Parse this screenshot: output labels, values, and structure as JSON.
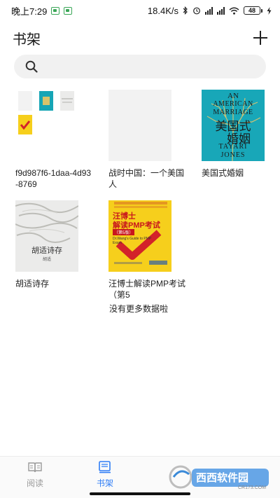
{
  "status_bar": {
    "time": "晚上7:29",
    "net_speed": "18.4K/s",
    "battery": "48",
    "colors": {
      "app_icon": "#3aa657",
      "battery": "#2fb14a"
    }
  },
  "header": {
    "title": "书架",
    "add_icon": "plus-icon"
  },
  "search": {
    "icon": "search-icon",
    "placeholder": ""
  },
  "shelf": {
    "books": [
      {
        "label": "f9d987f6-1daa-4d93-8769"
      },
      {
        "label": "战时中国：一个美国人"
      },
      {
        "label": "美国式婚姻"
      },
      {
        "label": "胡适诗存"
      },
      {
        "label": "汪博士解读PMP考试（第5"
      }
    ],
    "covers": {
      "american_marriage": {
        "line1": "AN",
        "line2": "AMERICAN",
        "line3": "MARRIAGE",
        "line4": "美国式",
        "line5": "婚姻",
        "line6": "TAYARI",
        "line7": "JONES",
        "color": "#18a7b8"
      },
      "poem": {
        "title": "胡适诗存",
        "subtitle": "胡适"
      },
      "pmp": {
        "line1": "汪博士",
        "line2": "解读PMP",
        "line3": "考试",
        "edition": "（第5版）",
        "english": "Dr.Wang's Guide to PMP Exam",
        "color": "#f6cf1c"
      }
    },
    "no_more": "没有更多数据啦"
  },
  "bottom_nav": {
    "items": [
      {
        "label": "阅读",
        "icon": "open-book-icon",
        "active": false
      },
      {
        "label": "书架",
        "icon": "bookshelf-icon",
        "active": true
      }
    ],
    "active_color": "#2f7df6",
    "inactive_color": "#9a9a9a"
  },
  "watermark": {
    "text": "西西软件园",
    "url": "CR173.COM"
  }
}
